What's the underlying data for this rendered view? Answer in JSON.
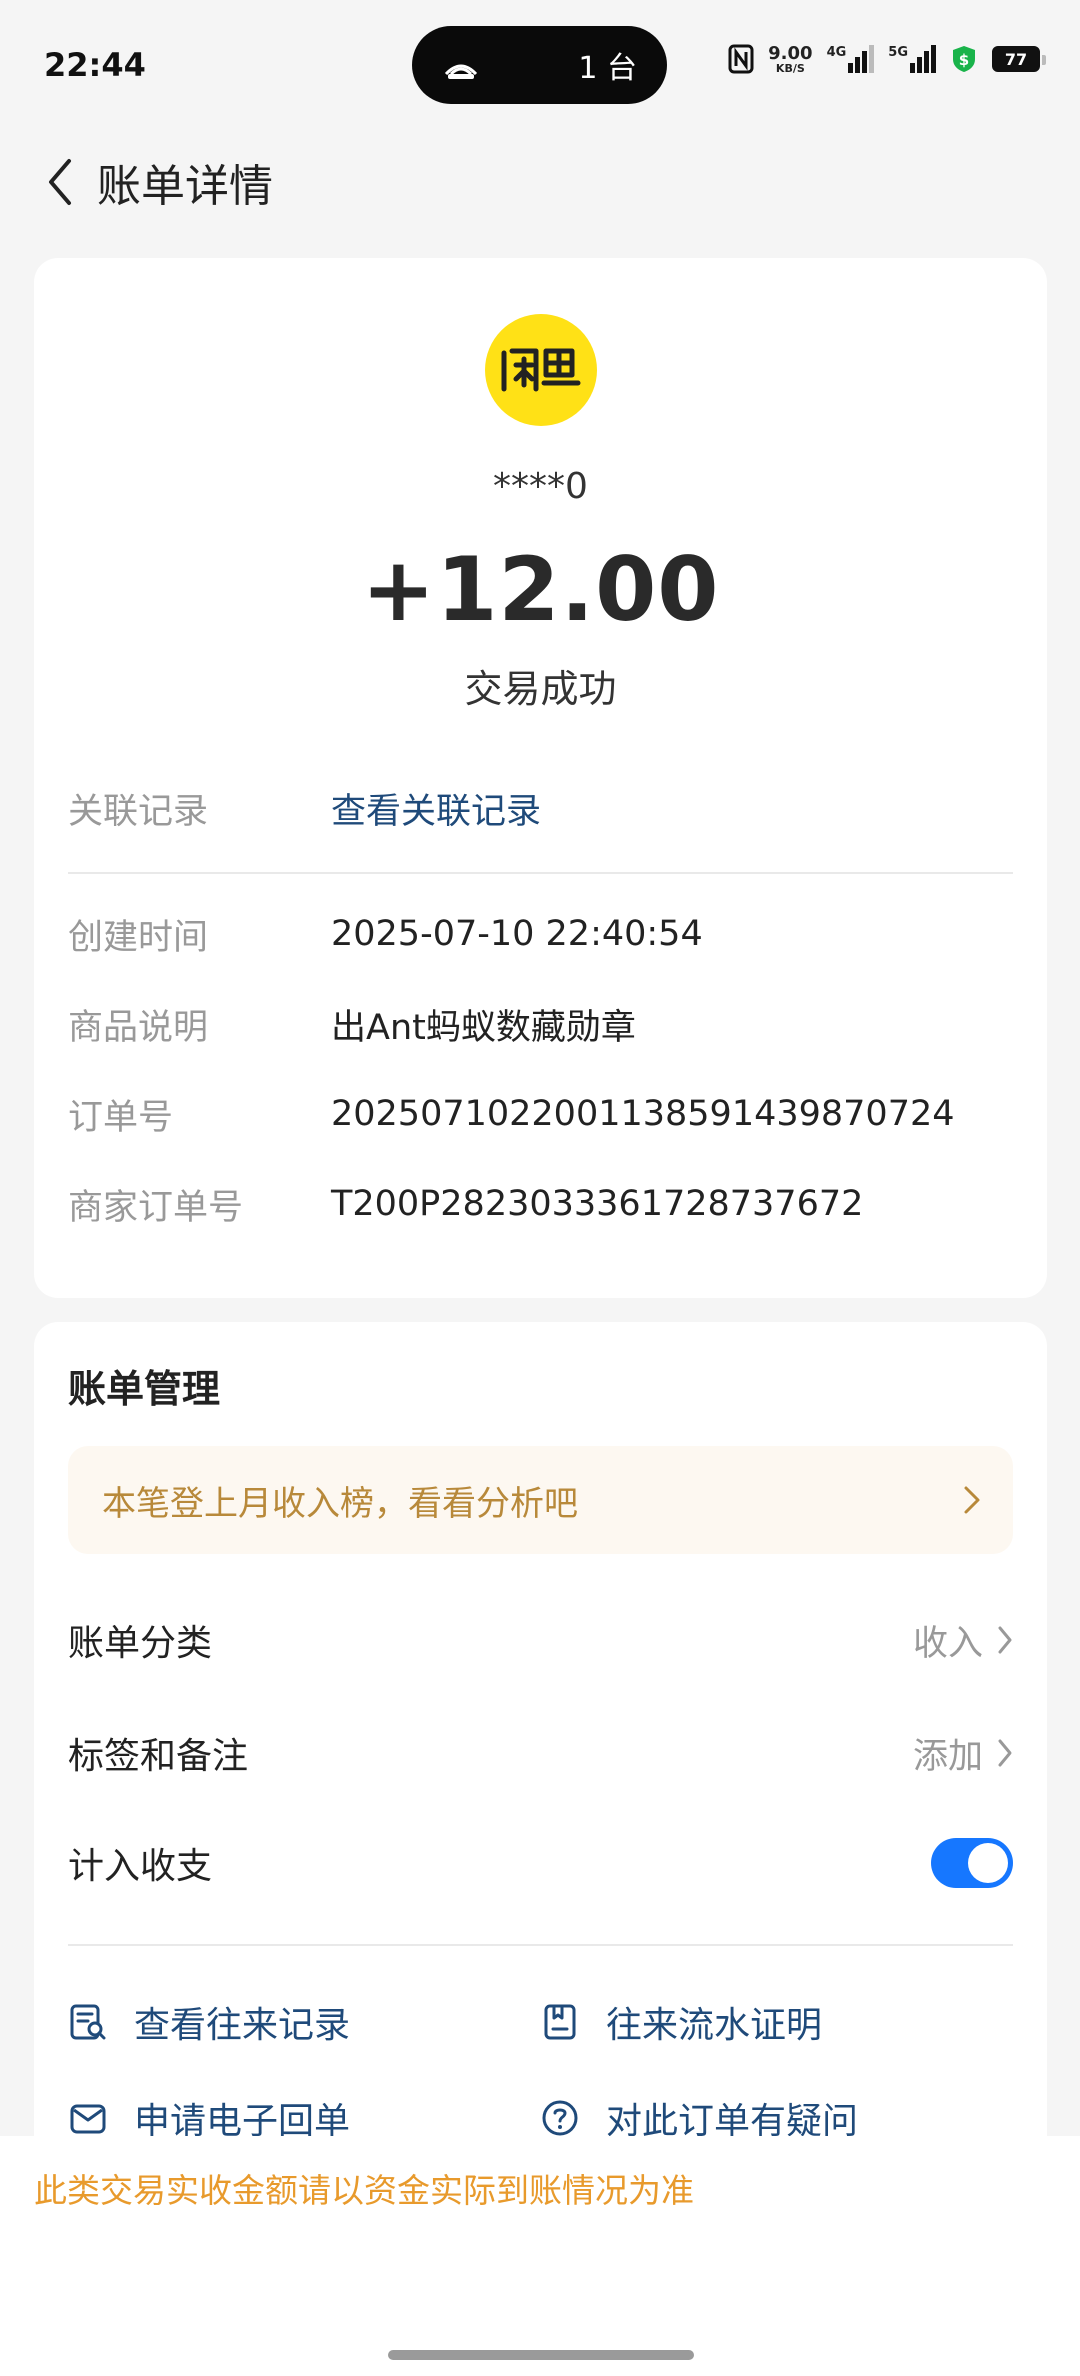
{
  "status_bar": {
    "time": "22:44",
    "island_text": "1 台",
    "network_speed": "9.00",
    "network_unit": "KB/S",
    "signal1": "4G",
    "signal2": "5G",
    "battery": "77"
  },
  "header": {
    "title": "账单详情"
  },
  "detail": {
    "merchant_name": "****0",
    "amount": "+12.00",
    "status": "交易成功",
    "related": {
      "label": "关联记录",
      "value": "查看关联记录"
    },
    "rows": [
      {
        "label": "创建时间",
        "value": "2025-07-10 22:40:54"
      },
      {
        "label": "商品说明",
        "value": "出Ant蚂蚁数藏勋章"
      },
      {
        "label": "订单号",
        "value": "2025071022001138591439870724"
      },
      {
        "label": "商家订单号",
        "value": "T200P2823033361728737672"
      }
    ]
  },
  "manage": {
    "title": "账单管理",
    "banner_text": "本笔登上月收入榜，看看分析吧",
    "category": {
      "label": "账单分类",
      "value": "收入"
    },
    "tags": {
      "label": "标签和备注",
      "value": "添加"
    },
    "include": {
      "label": "计入收支",
      "enabled": true
    },
    "actions": {
      "history": "查看往来记录",
      "statement": "往来流水证明",
      "receipt": "申请电子回单",
      "question": "对此订单有疑问"
    }
  },
  "footer": {
    "notice": "此类交易实收金额请以资金实际到账情况为准"
  },
  "colors": {
    "link": "#1f4a7a",
    "toggle": "#1677ff",
    "banner_text": "#b8893a",
    "notice": "#e89a2c",
    "logo_bg": "#ffe116"
  }
}
